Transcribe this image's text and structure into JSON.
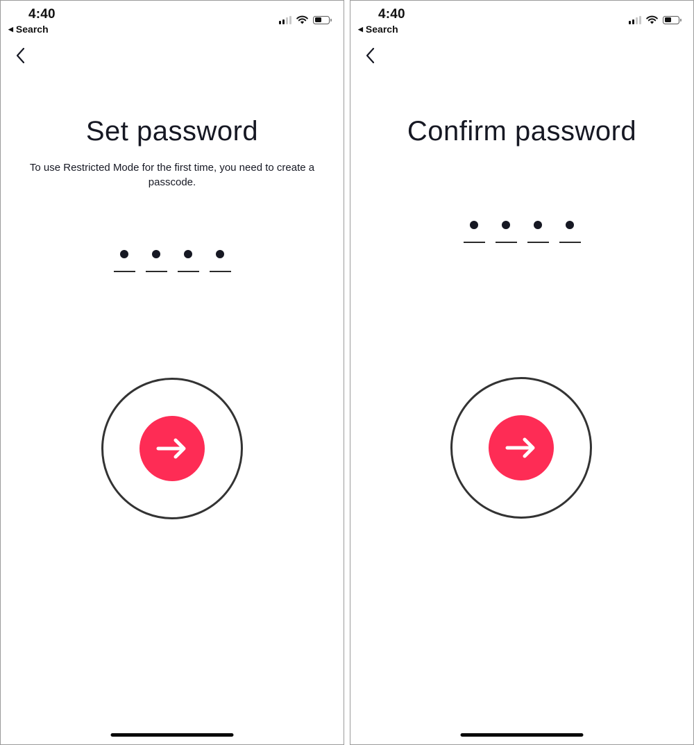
{
  "screens": [
    {
      "status_bar": {
        "time": "4:40",
        "back_app_label": "Search",
        "icons": [
          "signal-icon",
          "wifi-icon",
          "battery-icon"
        ],
        "signal_bars_active": 2,
        "signal_bars_total": 4,
        "battery_level_fraction": 0.45
      },
      "nav": {
        "back_icon": "chevron-left-icon"
      },
      "title": "Set password",
      "subtitle": "To use Restricted Mode for the first time, you need to create a passcode.",
      "passcode": {
        "length": 4,
        "filled": 4,
        "mask_char": "•"
      },
      "next_button": {
        "icon": "arrow-right-icon",
        "color": "#fe2c55"
      }
    },
    {
      "status_bar": {
        "time": "4:40",
        "back_app_label": "Search",
        "icons": [
          "signal-icon",
          "wifi-icon",
          "battery-icon"
        ],
        "signal_bars_active": 2,
        "signal_bars_total": 4,
        "battery_level_fraction": 0.45
      },
      "nav": {
        "back_icon": "chevron-left-icon"
      },
      "title": "Confirm password",
      "subtitle": "",
      "passcode": {
        "length": 4,
        "filled": 4,
        "mask_char": "•"
      },
      "next_button": {
        "icon": "arrow-right-icon",
        "color": "#fe2c55"
      }
    }
  ],
  "colors": {
    "accent": "#fe2c55",
    "text": "#161823",
    "ring": "#333333"
  }
}
